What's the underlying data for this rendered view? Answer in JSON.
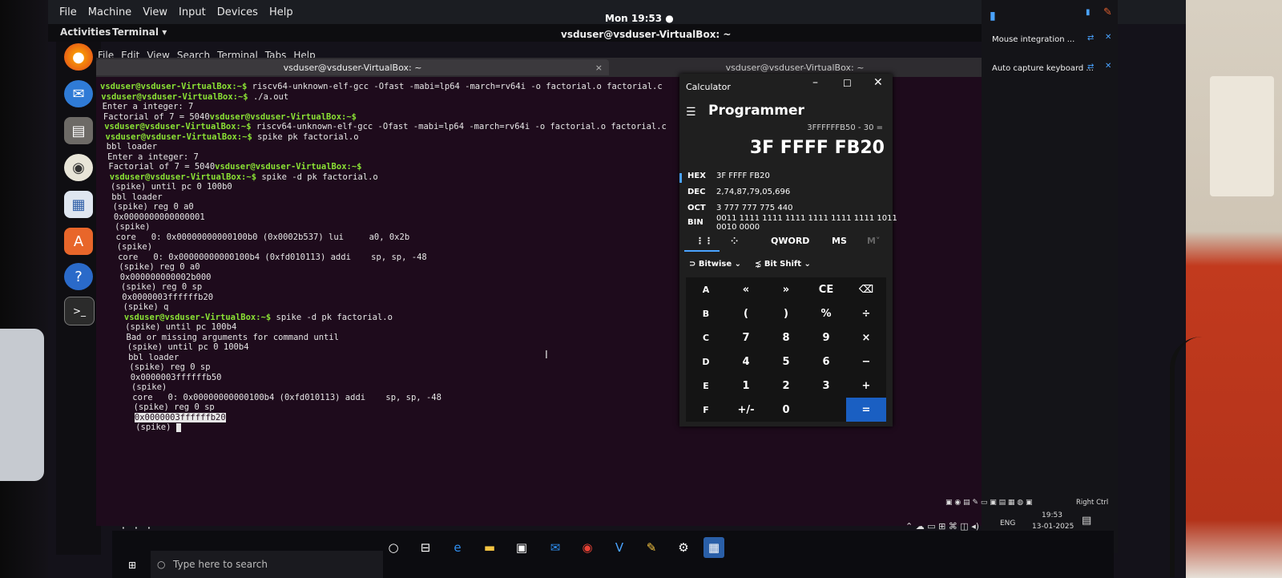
{
  "vbox_menu": [
    "File",
    "Machine",
    "View",
    "Input",
    "Devices",
    "Help"
  ],
  "gnome": {
    "activities": "Activities",
    "app": "Terminal ▾",
    "clock": "Mon 19:53 ●"
  },
  "window_title": "vsduser@vsduser-VirtualBox: ~",
  "terminal_menu": [
    "File",
    "Edit",
    "View",
    "Search",
    "Terminal",
    "Tabs",
    "Help"
  ],
  "tabs": [
    {
      "label": "vsduser@vsduser-VirtualBox: ~",
      "close": "×"
    },
    {
      "label": "vsduser@vsduser-VirtualBox: ~",
      "close": ""
    }
  ],
  "terminal_lines": [
    {
      "prompt": "vsduser@vsduser-VirtualBox:~$",
      "text": " riscv64-unknown-elf-gcc -Ofast -mabi=lp64 -march=rv64i -o factorial.o factorial.c"
    },
    {
      "prompt": "vsduser@vsduser-VirtualBox:~$",
      "text": " ./a.out"
    },
    {
      "prompt": "",
      "text": "Enter a integer: 7"
    },
    {
      "prompt": "",
      "text": "Factorial of 7 = 5040",
      "tail": "vsduser@vsduser-VirtualBox:~$"
    },
    {
      "prompt": "vsduser@vsduser-VirtualBox:~$",
      "text": " riscv64-unknown-elf-gcc -Ofast -mabi=lp64 -march=rv64i -o factorial.o factorial.c"
    },
    {
      "prompt": "vsduser@vsduser-VirtualBox:~$",
      "text": " spike pk factorial.o"
    },
    {
      "prompt": "",
      "text": "bbl loader"
    },
    {
      "prompt": "",
      "text": "Enter a integer: 7"
    },
    {
      "prompt": "",
      "text": "Factorial of 7 = 5040",
      "tail": "vsduser@vsduser-VirtualBox:~$"
    },
    {
      "prompt": "vsduser@vsduser-VirtualBox:~$",
      "text": " spike -d pk factorial.o"
    },
    {
      "prompt": "",
      "text": "(spike) until pc 0 100b0"
    },
    {
      "prompt": "",
      "text": "bbl loader"
    },
    {
      "prompt": "",
      "text": "(spike) reg 0 a0"
    },
    {
      "prompt": "",
      "text": "0x0000000000000001"
    },
    {
      "prompt": "",
      "text": "(spike)"
    },
    {
      "prompt": "",
      "text": "core   0: 0x00000000000100b0 (0x0002b537) lui     a0, 0x2b"
    },
    {
      "prompt": "",
      "text": "(spike)"
    },
    {
      "prompt": "",
      "text": "core   0: 0x00000000000100b4 (0xfd010113) addi    sp, sp, -48"
    },
    {
      "prompt": "",
      "text": "(spike) reg 0 a0"
    },
    {
      "prompt": "",
      "text": "0x000000000002b000"
    },
    {
      "prompt": "",
      "text": "(spike) reg 0 sp"
    },
    {
      "prompt": "",
      "text": "0x0000003ffffffb20"
    },
    {
      "prompt": "",
      "text": "(spike) q"
    },
    {
      "prompt": "vsduser@vsduser-VirtualBox:~$",
      "text": " spike -d pk factorial.o"
    },
    {
      "prompt": "",
      "text": "(spike) until pc 100b4"
    },
    {
      "prompt": "",
      "text": "Bad or missing arguments for command until"
    },
    {
      "prompt": "",
      "text": "(spike) until pc 0 100b4"
    },
    {
      "prompt": "",
      "text": "bbl loader"
    },
    {
      "prompt": "",
      "text": "(spike) reg 0 sp"
    },
    {
      "prompt": "",
      "text": "0x0000003ffffffb50"
    },
    {
      "prompt": "",
      "text": "(spike)"
    },
    {
      "prompt": "",
      "text": "core   0: 0x00000000000100b4 (0xfd010113) addi    sp, sp, -48"
    },
    {
      "prompt": "",
      "text": "(spike) reg 0 sp"
    },
    {
      "prompt": "",
      "selected": "0x0000003ffffffb20"
    },
    {
      "prompt": "",
      "text": "(spike) ",
      "cursor": true
    }
  ],
  "calculator": {
    "title": "Calculator",
    "mode": "Programmer",
    "menu_icon": "hamburger-icon",
    "expression": "3FFFFFFB50 - 30 =",
    "result": "3F FFFF FB20",
    "radix": [
      {
        "label": "HEX",
        "value": "3F FFFF FB20"
      },
      {
        "label": "DEC",
        "value": "2,74,87,79,05,696"
      },
      {
        "label": "OCT",
        "value": "3 777 777 775 440"
      },
      {
        "label": "BIN",
        "value": "0011 1111 1111 1111 1111 1111 1111 1011\n0010 0000"
      }
    ],
    "word_size": "QWORD",
    "memory": "MS",
    "memory_dim": "M˅",
    "bitwise": "Bitwise ⌄",
    "bitshift": "Bit Shift ⌄",
    "keys": [
      "A",
      "«",
      "»",
      "CE",
      "⌫",
      "B",
      "(",
      ")",
      "%",
      "÷",
      "C",
      "7",
      "8",
      "9",
      "×",
      "D",
      "4",
      "5",
      "6",
      "−",
      "E",
      "1",
      "2",
      "3",
      "+",
      "F",
      "+/-",
      "0",
      "",
      "="
    ]
  },
  "vm_panel": {
    "mouse": "Mouse integration ...",
    "keyboard": "Auto capture keyboard ..."
  },
  "taskbar": {
    "search_placeholder": "Type here to search",
    "lang": "ENG",
    "time": "19:53",
    "date": "13-01-2025",
    "right_ctrl": "Right Ctrl"
  },
  "colors": {
    "prompt": "#8ae234",
    "terminal_bg": "#1e0b1c",
    "calc_bg": "#1f1f1f",
    "accent": "#1a5fc2"
  }
}
